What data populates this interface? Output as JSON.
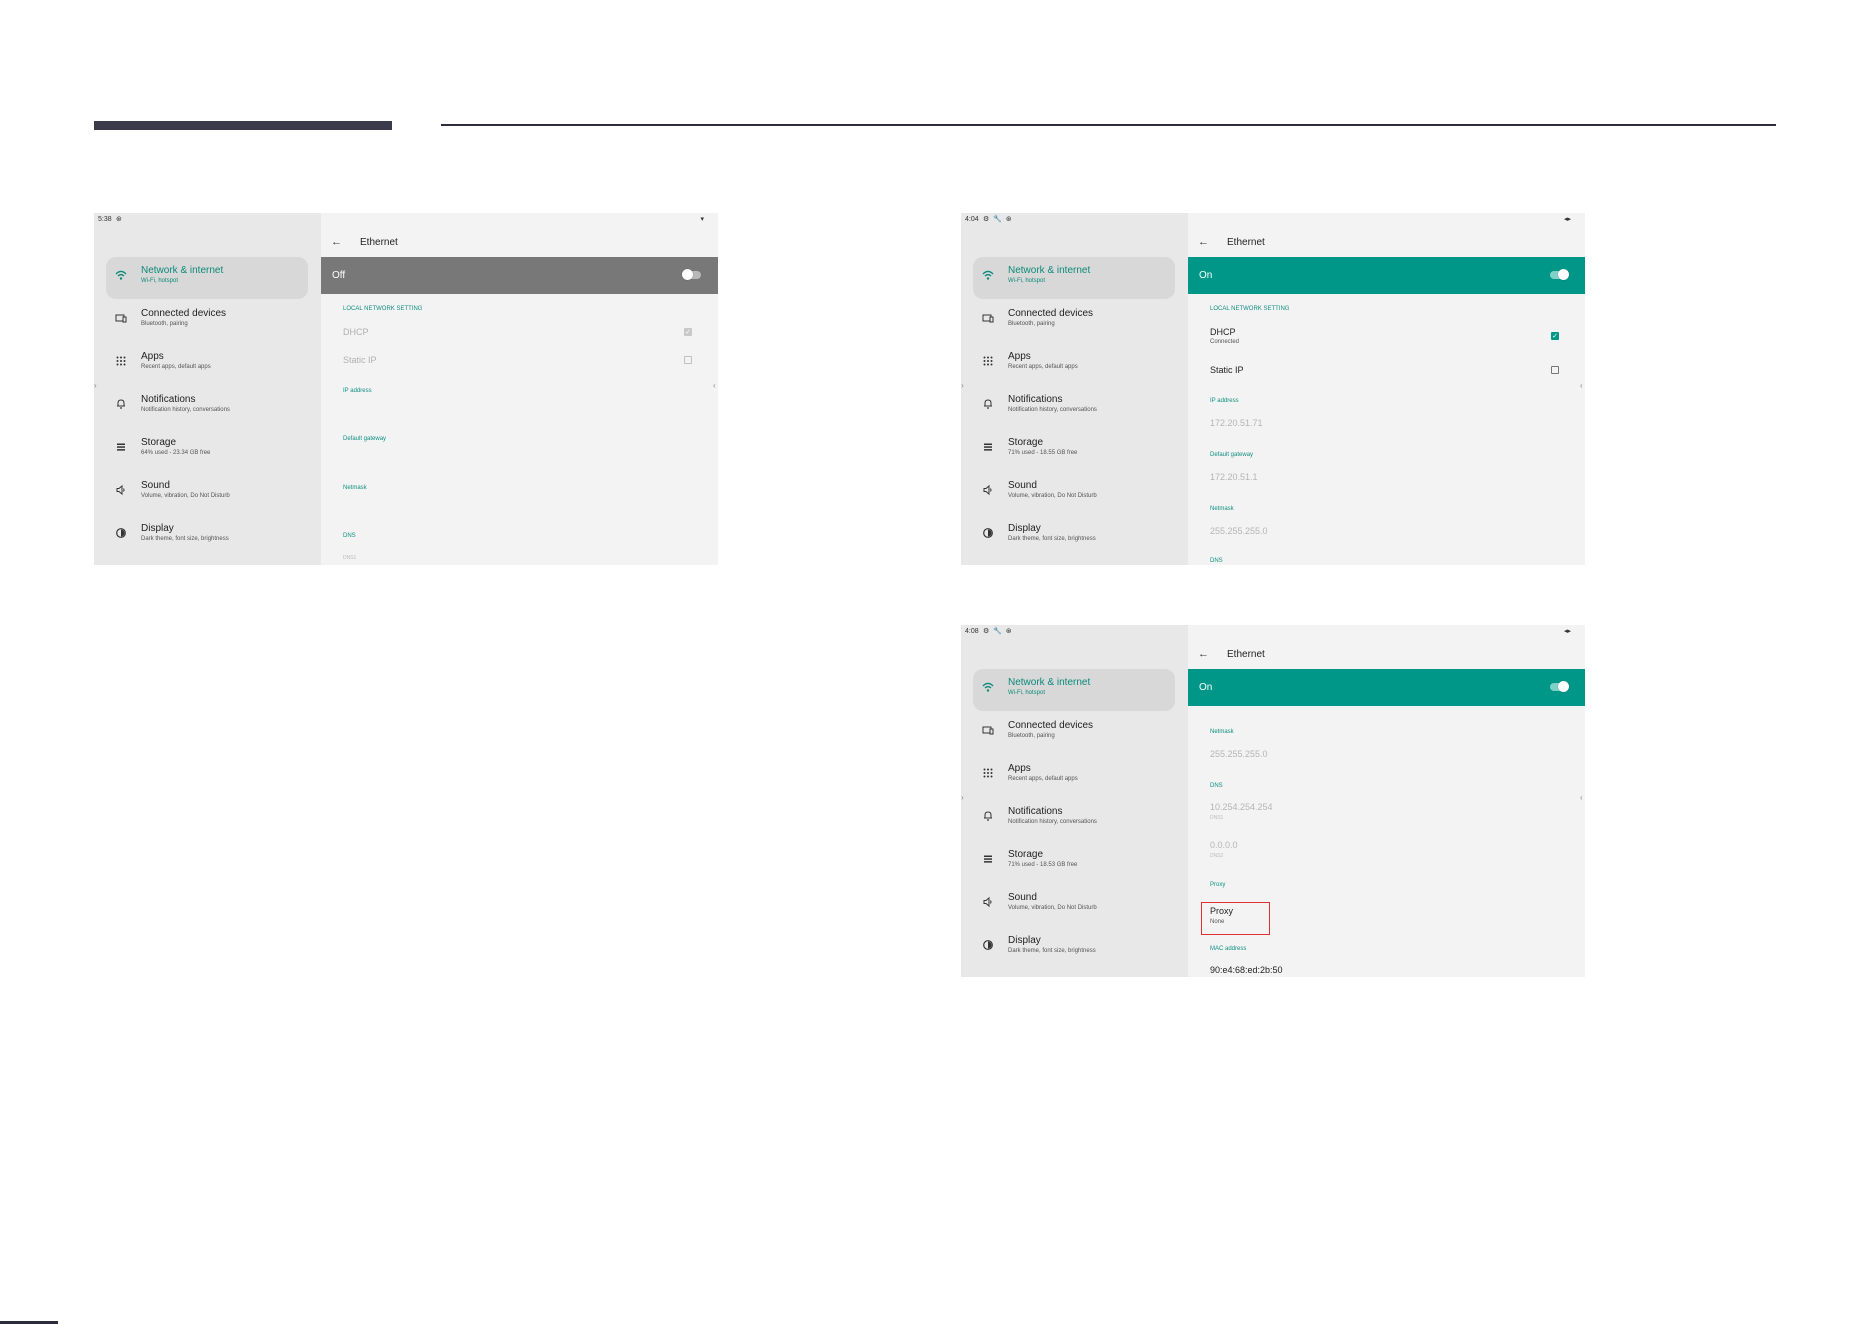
{
  "nav": [
    {
      "title": "Network & internet",
      "sub": "Wi-Fi, hotspot",
      "icon": "wifi-icon"
    },
    {
      "title": "Connected devices",
      "sub": "Bluetooth, pairing",
      "icon": "devices-icon"
    },
    {
      "title": "Apps",
      "sub": "Recent apps, default apps",
      "icon": "apps-grid-icon"
    },
    {
      "title": "Notifications",
      "sub": "Notification history, conversations",
      "icon": "bell-icon"
    },
    {
      "title": "Storage",
      "icon": "storage-icon"
    },
    {
      "title": "Sound",
      "sub": "Volume, vibration, Do Not Disturb",
      "icon": "speaker-icon"
    },
    {
      "title": "Display",
      "sub": "Dark theme, font size, brightness",
      "icon": "display-icon"
    }
  ],
  "shotA": {
    "time": "5:38",
    "status_icons": "⊛",
    "status_right": "▾",
    "title": "Ethernet",
    "toggle": "Off",
    "storage_sub": "64% used - 23.34 GB free",
    "local_setting": "LOCAL NETWORK SETTING",
    "dhcp": "DHCP",
    "static_ip": "Static IP",
    "ip_label": "IP address",
    "gateway_label": "Default gateway",
    "netmask_label": "Netmask",
    "dns_label": "DNS",
    "dns1_label": "DNS1"
  },
  "shotB": {
    "time": "4:04",
    "status_icons": "⚙ 🔧 ⊛",
    "status_right": "◂▸",
    "title": "Ethernet",
    "toggle": "On",
    "storage_sub": "71% used - 18.55 GB free",
    "local_setting": "LOCAL NETWORK SETTING",
    "dhcp": "DHCP",
    "dhcp_sub": "Connected",
    "static_ip": "Static IP",
    "ip_label": "IP address",
    "ip_value": "172.20.51.71",
    "gateway_label": "Default gateway",
    "gateway_value": "172.20.51.1",
    "netmask_label": "Netmask",
    "netmask_value": "255.255.255.0",
    "dns_label": "DNS"
  },
  "shotC": {
    "time": "4:08",
    "status_icons": "⚙ 🔧 ⊛",
    "status_right": "◂▸",
    "title": "Ethernet",
    "toggle": "On",
    "storage_sub": "71% used - 18.53 GB free",
    "netmask_label": "Netmask",
    "netmask_value": "255.255.255.0",
    "dns_label": "DNS",
    "dns1_value": "10.254.254.254",
    "dns1_label": "DNS1",
    "dns2_value": "0.0.0.0",
    "dns2_label": "DNS2",
    "proxy_section": "Proxy",
    "proxy_title": "Proxy",
    "proxy_value": "None",
    "mac_label": "MAC address",
    "mac_value": "90:e4:68:ed:2b:50"
  },
  "colors": {
    "accent": "#009688",
    "toggle_off": "#787878",
    "highlight": "#e03030"
  }
}
